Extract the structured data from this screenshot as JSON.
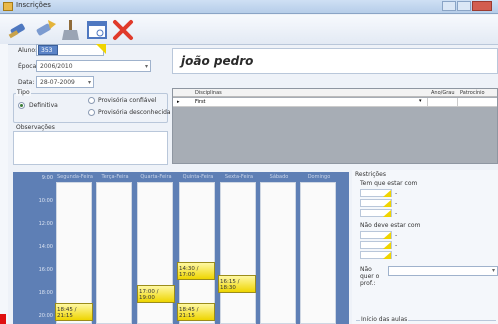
{
  "window": {
    "title": "Inscrições"
  },
  "toolbar": {
    "icons": [
      "brush-icon",
      "brush-arrow-icon",
      "broom-icon",
      "window-icon",
      "close-x-icon"
    ]
  },
  "form": {
    "aluno_label": "Aluno:",
    "aluno_value": "353",
    "epoca_label": "Época",
    "epoca_value": "2006/2010",
    "data_label": "Data:",
    "data_value": "28-07-2009",
    "tipo_label": "Tipo",
    "tipo_options": [
      "Definitiva",
      "Provisória confiável",
      "Provisória desconhecida"
    ],
    "tipo_selected": "Definitiva",
    "observacoes_label": "Observações",
    "student_name": "joão pedro"
  },
  "grid": {
    "headers": [
      "Disciplinas",
      "Ano/Grau",
      "Patrocínio"
    ],
    "rows": [
      {
        "disciplina": "First"
      }
    ]
  },
  "schedule": {
    "days": [
      "Segunda-Feira",
      "Terça-Feira",
      "Quarta-Feira",
      "Quinta-Feira",
      "Sexta-Feira",
      "Sábado",
      "Domingo"
    ],
    "hours": [
      "9:00",
      "10:00",
      "12:00",
      "14:00",
      "16:00",
      "18:00",
      "20:00"
    ],
    "events": [
      {
        "label": "18:45 / 21:15",
        "day": "Segunda-Feira"
      },
      {
        "label": "17:00 / 19:00",
        "day": "Quarta-Feira"
      },
      {
        "label": "14:30 / 17:00",
        "day": "Quinta-Feira"
      },
      {
        "label": "18:45 / 21:15",
        "day": "Quinta-Feira"
      },
      {
        "label": "16:15 / 18:30",
        "day": "Sexta-Feira"
      }
    ]
  },
  "restricoes": {
    "title": "Restrições",
    "tem_que_estar": "Tem que estar com",
    "nao_deve": "Não deve estar com",
    "nao_quer": "Não quer o prof.:",
    "inicio_aulas": "Início das aulas"
  }
}
